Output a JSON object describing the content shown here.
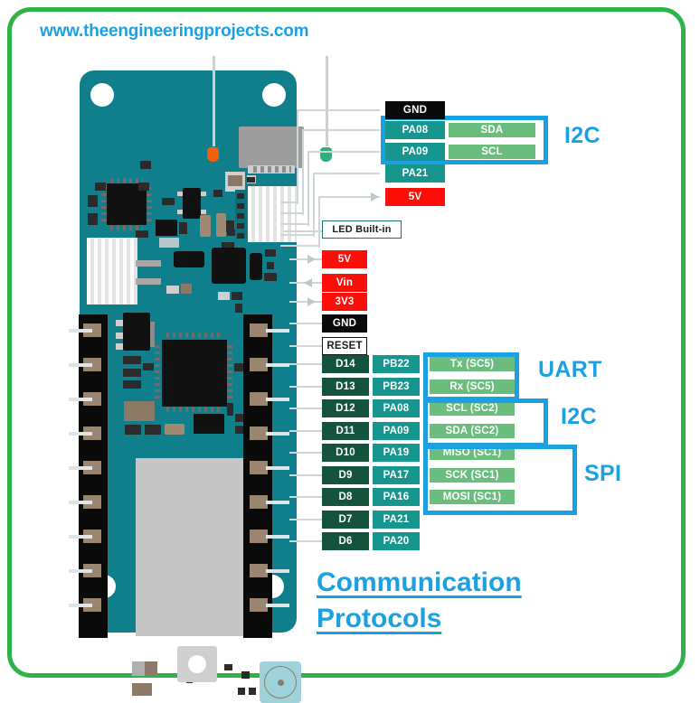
{
  "site_url": "www.theengineeringprojects.com",
  "title": {
    "line1": "Communication",
    "line2": "Protocols"
  },
  "colors": {
    "frame_green": "#2eb34a",
    "accent_blue": "#1ba1e2",
    "teal": "#17958f",
    "dark_green": "#14543f",
    "light_green": "#6bbd7e",
    "red": "#fb0f08",
    "black": "#0a0a0a",
    "board_teal": "#0f7f8c"
  },
  "top_header": {
    "rows": [
      {
        "pin": "GND",
        "style": "black",
        "func": null,
        "func_style": null,
        "arrow": "line"
      },
      {
        "pin": "PA08",
        "style": "teal",
        "func": "SDA",
        "func_style": "green",
        "arrow": "line"
      },
      {
        "pin": "PA09",
        "style": "teal",
        "func": "SCL",
        "func_style": "green",
        "arrow": "line"
      },
      {
        "pin": "PA21",
        "style": "teal",
        "func": null,
        "func_style": null,
        "arrow": "line"
      },
      {
        "pin": "5V",
        "style": "red",
        "func": null,
        "func_style": null,
        "arrow": "right"
      }
    ],
    "group_label": "I2C"
  },
  "middle": {
    "led_label": "LED Built-in",
    "rows": [
      {
        "pin": "5V",
        "style": "red",
        "arrow": "right"
      },
      {
        "pin": "Vin",
        "style": "red",
        "arrow": "left"
      },
      {
        "pin": "3V3",
        "style": "red",
        "arrow": "right"
      },
      {
        "pin": "GND",
        "style": "black",
        "arrow": "line"
      },
      {
        "pin": "RESET",
        "style": "white-black",
        "arrow": "line"
      }
    ]
  },
  "digital_pins": {
    "rows": [
      {
        "pin": "D14",
        "port": "PB22",
        "func": "Tx (SC5)",
        "group": "UART"
      },
      {
        "pin": "D13",
        "port": "PB23",
        "func": "Rx (SC5)",
        "group": "UART"
      },
      {
        "pin": "D12",
        "port": "PA08",
        "func": "SCL (SC2)",
        "group": "I2C"
      },
      {
        "pin": "D11",
        "port": "PA09",
        "func": "SDA (SC2)",
        "group": "I2C"
      },
      {
        "pin": "D10",
        "port": "PA19",
        "func": "MISO (SC1)",
        "group": "SPI"
      },
      {
        "pin": "D9",
        "port": "PA17",
        "func": "SCK (SC1)",
        "group": "SPI"
      },
      {
        "pin": "D8",
        "port": "PA16",
        "func": "MOSI (SC1)",
        "group": "SPI"
      },
      {
        "pin": "D7",
        "port": "PA21",
        "func": null,
        "group": null
      },
      {
        "pin": "D6",
        "port": "PA20",
        "func": null,
        "group": null
      }
    ]
  },
  "protocol_labels": {
    "uart": "UART",
    "i2c": "I2C",
    "spi": "SPI"
  }
}
